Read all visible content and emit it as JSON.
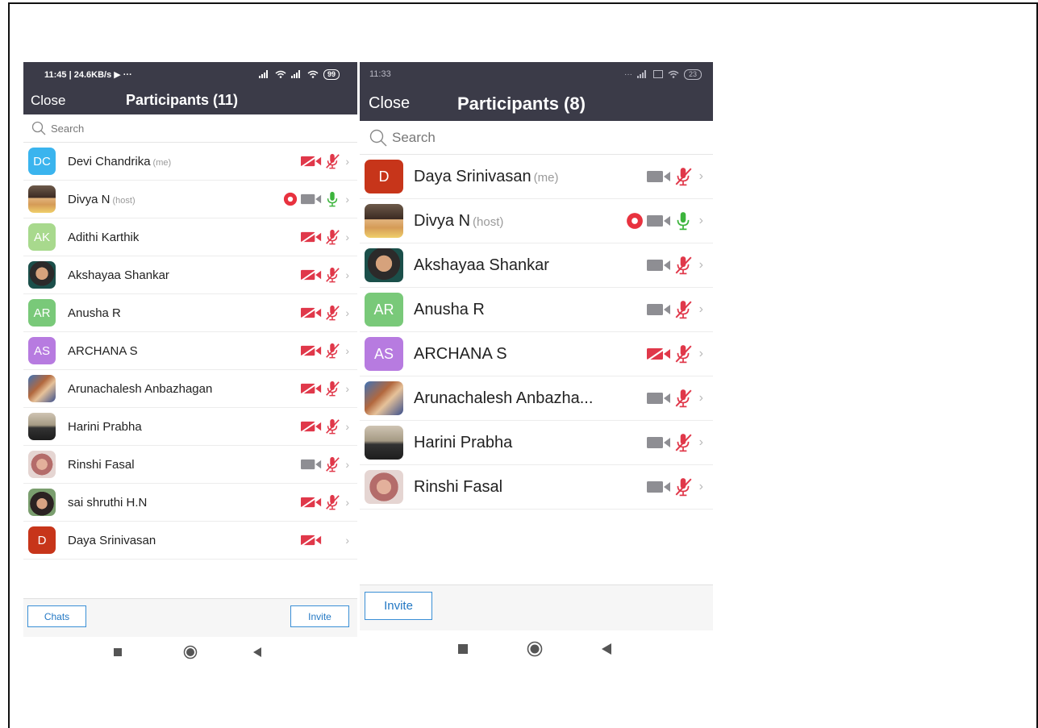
{
  "colors": {
    "header_bg": "#3b3b48",
    "accent_blue": "#2378c4",
    "muted_red": "#e0384a",
    "unmuted_green": "#3cb43c",
    "record_red": "#e8323f",
    "video_gray": "#8e8e93",
    "avatar_blue": "#3ab4ee",
    "avatar_green": "#79c979",
    "avatar_purple": "#b77be0",
    "avatar_dark_red": "#c7351a"
  },
  "phone1": {
    "status": {
      "time": "11:45 | 24.6KB/s",
      "extra": "▶ ···",
      "battery": "99"
    },
    "close_label": "Close",
    "title": "Participants (11)",
    "search_placeholder": "Search",
    "participants": [
      {
        "name": "Devi Chandrika",
        "tag": "(me)",
        "initials": "DC",
        "avatar": "initials",
        "color": "#3ab4ee",
        "video": "off",
        "mic": "muted",
        "recording": false
      },
      {
        "name": "Divya N",
        "tag": "(host)",
        "initials": "",
        "avatar": "photo-divya",
        "color": "",
        "video": "on",
        "mic": "on",
        "recording": true
      },
      {
        "name": "Adithi Karthik",
        "tag": "",
        "initials": "AK",
        "avatar": "initials",
        "color": "#a8d98d",
        "video": "off",
        "mic": "muted",
        "recording": false
      },
      {
        "name": "Akshayaa Shankar",
        "tag": "",
        "initials": "",
        "avatar": "photo-akshayaa",
        "color": "",
        "video": "off",
        "mic": "muted",
        "recording": false
      },
      {
        "name": "Anusha R",
        "tag": "",
        "initials": "AR",
        "avatar": "initials",
        "color": "#79c979",
        "video": "off",
        "mic": "muted",
        "recording": false
      },
      {
        "name": "ARCHANA S",
        "tag": "",
        "initials": "AS",
        "avatar": "initials",
        "color": "#b77be0",
        "video": "off",
        "mic": "muted",
        "recording": false
      },
      {
        "name": "Arunachalesh Anbazhagan",
        "tag": "",
        "initials": "",
        "avatar": "photo-arun",
        "color": "",
        "video": "off",
        "mic": "muted",
        "recording": false
      },
      {
        "name": "Harini Prabha",
        "tag": "",
        "initials": "",
        "avatar": "photo-harini",
        "color": "",
        "video": "off",
        "mic": "muted",
        "recording": false
      },
      {
        "name": "Rinshi Fasal",
        "tag": "",
        "initials": "",
        "avatar": "photo-rinshi",
        "color": "",
        "video": "on",
        "mic": "muted",
        "recording": false
      },
      {
        "name": "sai shruthi H.N",
        "tag": "",
        "initials": "",
        "avatar": "photo-sai",
        "color": "",
        "video": "off",
        "mic": "muted",
        "recording": false
      },
      {
        "name": "Daya Srinivasan",
        "tag": "",
        "initials": "D",
        "avatar": "initials",
        "color": "#c7351a",
        "video": "off",
        "mic": "none",
        "recording": false
      }
    ],
    "chats_label": "Chats",
    "invite_label": "Invite"
  },
  "phone2": {
    "status": {
      "time": "11:33",
      "battery": "23"
    },
    "close_label": "Close",
    "title": "Participants (8)",
    "search_placeholder": "Search",
    "participants": [
      {
        "name": "Daya Srinivasan",
        "tag": "(me)",
        "initials": "D",
        "avatar": "initials",
        "color": "#c7351a",
        "video": "on",
        "mic": "muted",
        "recording": false
      },
      {
        "name": "Divya N",
        "tag": "(host)",
        "initials": "",
        "avatar": "photo-divya",
        "color": "",
        "video": "on",
        "mic": "on",
        "recording": true
      },
      {
        "name": "Akshayaa Shankar",
        "tag": "",
        "initials": "",
        "avatar": "photo-akshayaa",
        "color": "",
        "video": "on",
        "mic": "muted",
        "recording": false
      },
      {
        "name": "Anusha R",
        "tag": "",
        "initials": "AR",
        "avatar": "initials",
        "color": "#79c979",
        "video": "on",
        "mic": "muted",
        "recording": false
      },
      {
        "name": "ARCHANA S",
        "tag": "",
        "initials": "AS",
        "avatar": "initials",
        "color": "#b77be0",
        "video": "off",
        "mic": "muted",
        "recording": false
      },
      {
        "name": "Arunachalesh Anbazha...",
        "tag": "",
        "initials": "",
        "avatar": "photo-arun",
        "color": "",
        "video": "on",
        "mic": "muted",
        "recording": false
      },
      {
        "name": "Harini Prabha",
        "tag": "",
        "initials": "",
        "avatar": "photo-harini",
        "color": "",
        "video": "on",
        "mic": "muted",
        "recording": false
      },
      {
        "name": "Rinshi Fasal",
        "tag": "",
        "initials": "",
        "avatar": "photo-rinshi",
        "color": "",
        "video": "on",
        "mic": "muted",
        "recording": false
      }
    ],
    "invite_label": "Invite"
  },
  "icons": {
    "search": "search-icon",
    "recording": "recording-icon",
    "video_on": "video-camera-icon",
    "video_off": "video-off-icon",
    "mic_on": "microphone-icon",
    "mic_muted": "microphone-muted-icon",
    "chevron": "chevron-right-icon",
    "nav_square": "recents-square-icon",
    "nav_home": "home-circle-icon",
    "nav_back": "back-triangle-icon"
  }
}
